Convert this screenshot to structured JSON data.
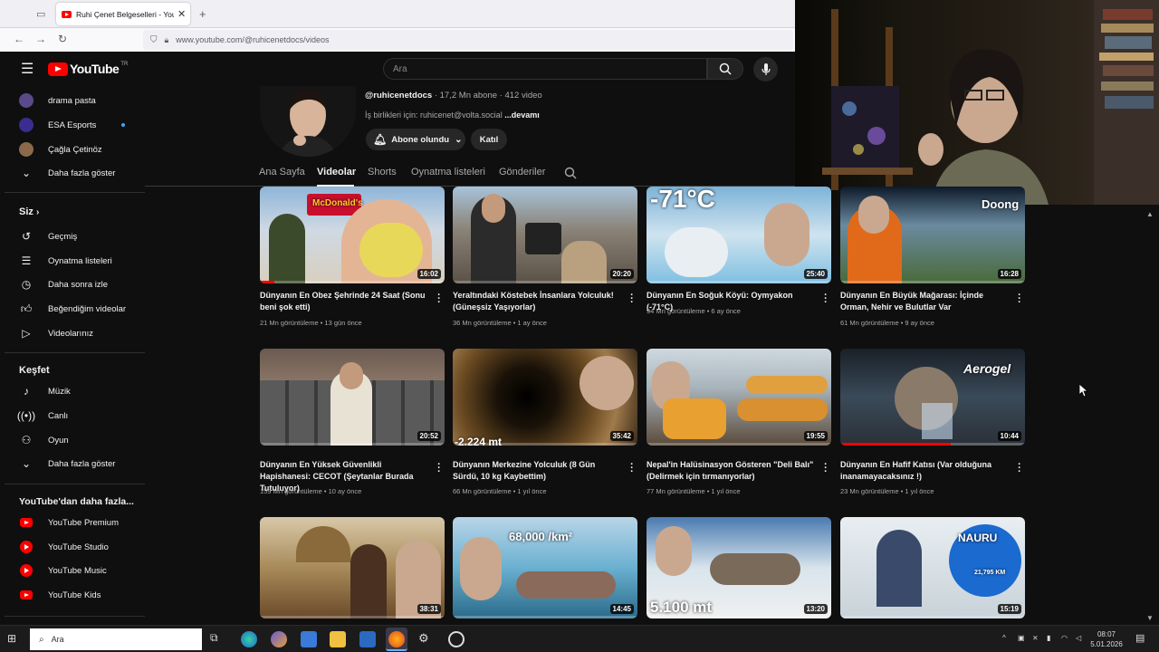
{
  "browser": {
    "tab_title": "Ruhi Çenet Belgeselleri - YouTube",
    "url": "www.youtube.com/@ruhicenetdocs/videos"
  },
  "masthead": {
    "logo_text": "YouTube",
    "logo_region": "TR",
    "search_placeholder": "Ara"
  },
  "sidebar": {
    "subscriptions": [
      {
        "label": "drama pasta",
        "color": "#5b4a8a"
      },
      {
        "label": "ESA Esports",
        "color": "#3a2d8f"
      },
      {
        "label": "Çağla Çetinöz",
        "color": "#8a6a4a"
      }
    ],
    "show_more_1": "Daha fazla göster",
    "you_heading": "Siz",
    "you_items": [
      {
        "label": "Geçmiş",
        "icon": "history-icon"
      },
      {
        "label": "Oynatma listeleri",
        "icon": "playlists-icon"
      },
      {
        "label": "Daha sonra izle",
        "icon": "watch-later-icon"
      },
      {
        "label": "Beğendiğim videolar",
        "icon": "like-icon"
      },
      {
        "label": "Videolarınız",
        "icon": "your-videos-icon"
      }
    ],
    "explore_heading": "Keşfet",
    "explore_items": [
      {
        "label": "Müzik",
        "icon": "music-icon"
      },
      {
        "label": "Canlı",
        "icon": "live-icon"
      },
      {
        "label": "Oyun",
        "icon": "gaming-icon"
      }
    ],
    "show_more_2": "Daha fazla göster",
    "more_heading": "YouTube'dan daha fazla...",
    "more_items": [
      {
        "label": "YouTube Premium"
      },
      {
        "label": "YouTube Studio"
      },
      {
        "label": "YouTube Music"
      },
      {
        "label": "YouTube Kids"
      }
    ]
  },
  "channel": {
    "handle": "@ruhicenetdocs",
    "stats": "· 17,2 Mn abone · 412 video",
    "contact": "İş birlikleri için: ruhicenet@volta.social",
    "more_link": "...devamı",
    "subscribed_label": "Abone olundu",
    "join_label": "Katıl"
  },
  "tabs": [
    {
      "label": "Ana Sayfa"
    },
    {
      "label": "Videolar"
    },
    {
      "label": "Shorts"
    },
    {
      "label": "Oynatma listeleri"
    },
    {
      "label": "Gönderiler"
    }
  ],
  "videos": [
    {
      "title": "Dünyanın En Obez Şehrinde 24 Saat (Sonu beni şok etti)",
      "views": "21 Mn görüntüleme",
      "age": "13 gün önce",
      "duration": "16:02",
      "overlay": "McDonald's"
    },
    {
      "title": "Yeraltındaki Köstebek İnsanlara Yolculuk! (Güneşsiz Yaşıyorlar)",
      "views": "36 Mn görüntüleme",
      "age": "1 ay önce",
      "duration": "20:20",
      "overlay": ""
    },
    {
      "title": "Dünyanın En Soğuk Köyü: Oymyakon (-71°C)",
      "views": "94 Mn görüntüleme",
      "age": "6 ay önce",
      "duration": "25:40",
      "overlay": "-71°C"
    },
    {
      "title": "Dünyanın En Büyük Mağarası: İçinde Orman, Nehir ve Bulutlar Var",
      "views": "61 Mn görüntüleme",
      "age": "9 ay önce",
      "duration": "16:28",
      "overlay": "Doong"
    },
    {
      "title": "Dünyanın En Yüksek Güvenlikli Hapishanesi: CECOT (Şeytanlar Burada Tutuluyor)",
      "views": "159 Mn görüntüleme",
      "age": "10 ay önce",
      "duration": "20:52",
      "overlay": ""
    },
    {
      "title": "Dünyanın Merkezine Yolculuk (8 Gün Sürdü, 10 kg Kaybettim)",
      "views": "66 Mn görüntüleme",
      "age": "1 yıl önce",
      "duration": "35:42",
      "overlay": "-2,224 mt"
    },
    {
      "title": "Nepal'in Halüsinasyon Gösteren \"Deli Balı\" (Delirmek için tırmanıyorlar)",
      "views": "77 Mn görüntüleme",
      "age": "1 yıl önce",
      "duration": "19:55",
      "overlay": ""
    },
    {
      "title": "Dünyanın En Hafif Katısı (Var olduğuna inanamayacaksınız !)",
      "views": "23 Mn görüntüleme",
      "age": "1 yıl önce",
      "duration": "10:44",
      "overlay": "Aerogel"
    },
    {
      "title": "",
      "views": "",
      "age": "",
      "duration": "38:31",
      "overlay": ""
    },
    {
      "title": "",
      "views": "",
      "age": "",
      "duration": "14:45",
      "overlay": "68,000 /km²"
    },
    {
      "title": "",
      "views": "",
      "age": "",
      "duration": "13:20",
      "overlay": "5.100 mt"
    },
    {
      "title": "",
      "views": "",
      "age": "",
      "duration": "15:19",
      "overlay": "NAURU"
    }
  ],
  "overlay_extra": {
    "nauru_distance": "21,795 KM"
  },
  "taskbar": {
    "search_placeholder": "Ara",
    "time": "08:07",
    "date": "5.01.2026"
  }
}
